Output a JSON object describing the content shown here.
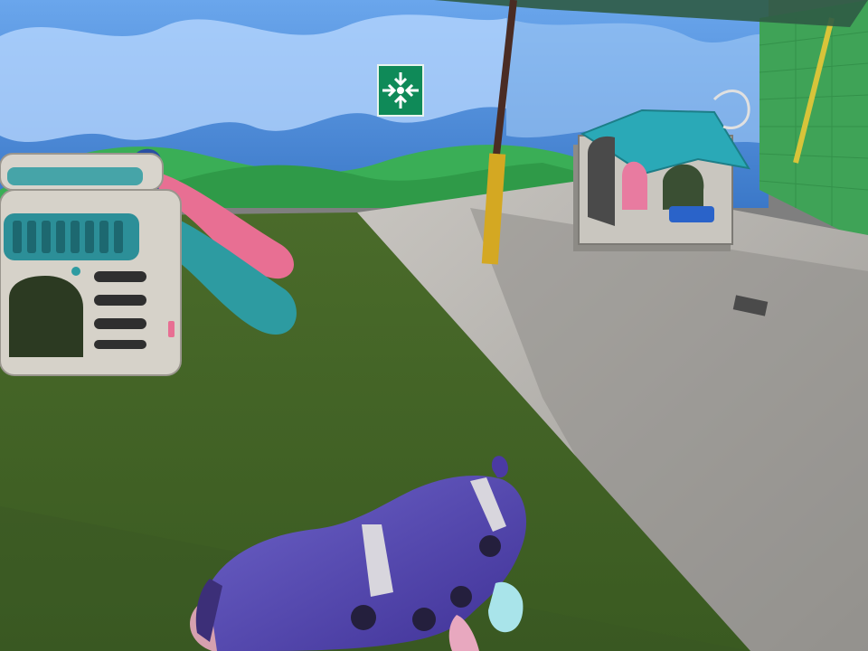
{
  "scene": {
    "description_visible_text": "",
    "colors": {
      "sky_wall": "#5f9be0",
      "cloud_light": "#c9e3ff",
      "hill_green": "#39b35a",
      "grass": "#4c6f2c",
      "grass_shadow": "#385526",
      "concrete": "#b8b5b0",
      "concrete_shadow": "#8c8a87",
      "green_brick_wall": "#3fa357",
      "slide_pink": "#e86f93",
      "slide_teal": "#2d9ba1",
      "climber_beige": "#d8d4cc",
      "playhouse_roof": "#2aa9b7",
      "caterpillar_purple": "#5a4bb4",
      "exit_sign_green": "#0f8a58",
      "pole_brown": "#4a2c24",
      "pole_wrap_yellow": "#d4a822"
    },
    "icons": {
      "exit_sign": "assembly-point-arrows-icon"
    }
  }
}
